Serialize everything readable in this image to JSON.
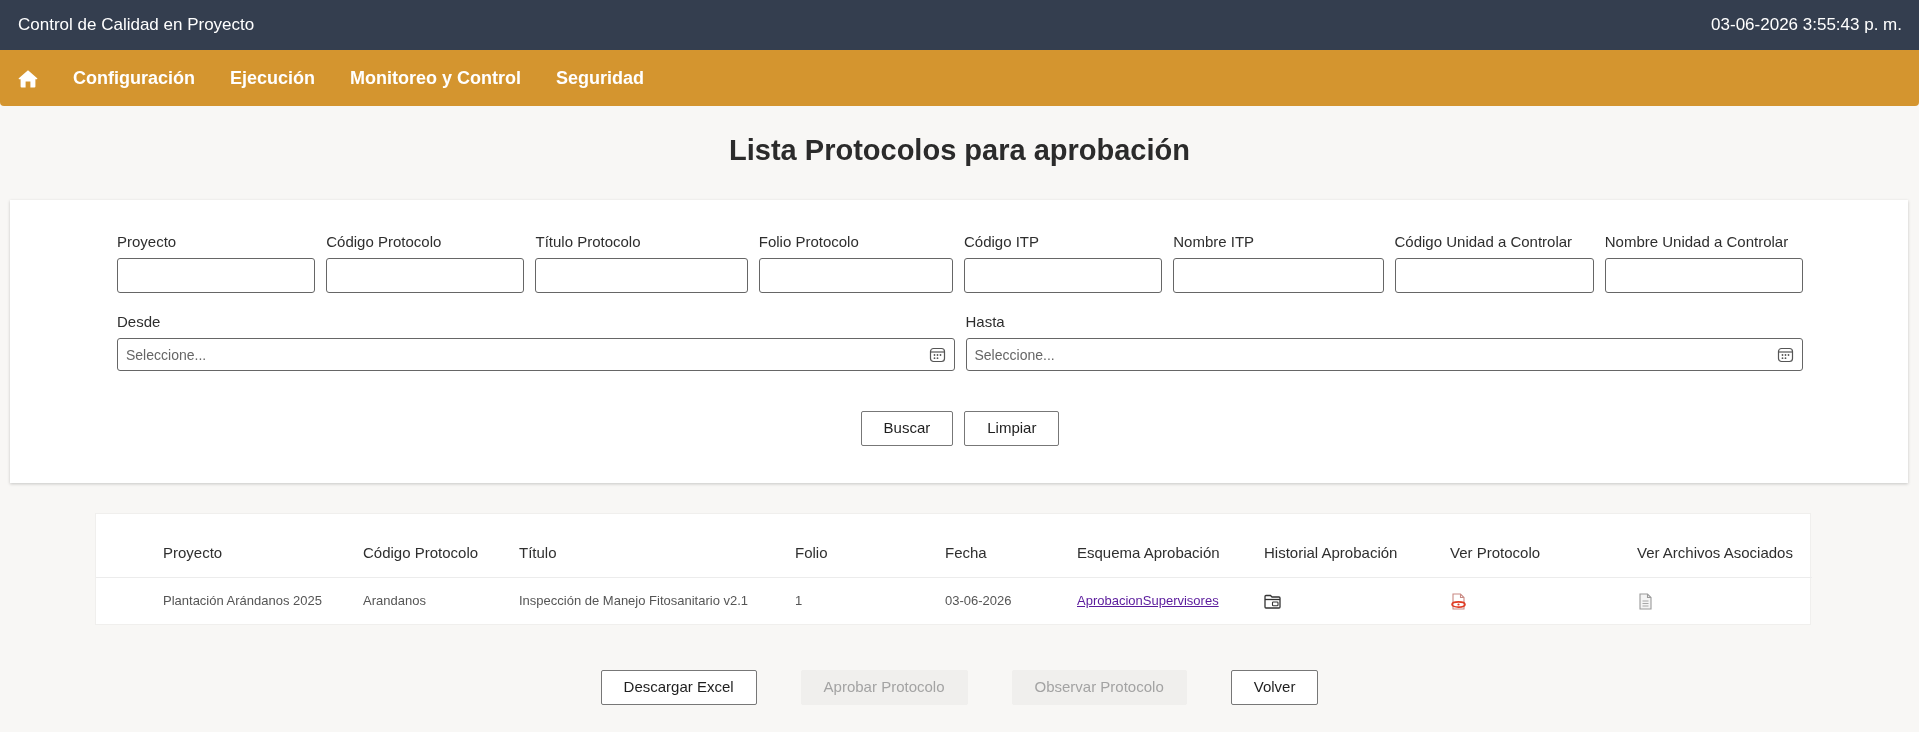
{
  "header": {
    "title": "Control de Calidad en Proyecto",
    "datetime": "03-06-2026 3:55:43 p. m."
  },
  "menu": [
    "Configuración",
    "Ejecución",
    "Monitoreo y Control",
    "Seguridad"
  ],
  "page_title": "Lista Protocolos para aprobación",
  "filters": {
    "fields": [
      {
        "label": "Proyecto"
      },
      {
        "label": "Código Protocolo"
      },
      {
        "label": "Título Protocolo"
      },
      {
        "label": "Folio Protocolo"
      },
      {
        "label": "Código ITP"
      },
      {
        "label": "Nombre ITP"
      },
      {
        "label": "Código Unidad a Controlar"
      },
      {
        "label": "Nombre Unidad a Controlar"
      }
    ],
    "date_fields": [
      {
        "label": "Desde",
        "placeholder": "Seleccione..."
      },
      {
        "label": "Hasta",
        "placeholder": "Seleccione..."
      }
    ],
    "buttons": [
      "Buscar",
      "Limpiar"
    ]
  },
  "table": {
    "columns": [
      "Proyecto",
      "Código Protocolo",
      "Título",
      "Folio",
      "Fecha",
      "Esquema Aprobación",
      "Historial Aprobación",
      "Ver Protocolo",
      "Ver Archivos Asociados"
    ],
    "rows": [
      {
        "cells": [
          {
            "kind": "text",
            "text": "Plantación Arándanos 2025"
          },
          {
            "kind": "text",
            "text": "Arandanos"
          },
          {
            "kind": "text",
            "text": "Inspección de Manejo Fitosanitario v2.1"
          },
          {
            "kind": "text",
            "text": "1"
          },
          {
            "kind": "text",
            "text": "03-06-2026"
          },
          {
            "kind": "link",
            "text": "AprobacionSupervisores"
          },
          {
            "kind": "history"
          },
          {
            "kind": "protocol"
          },
          {
            "kind": "files"
          }
        ]
      }
    ]
  },
  "actions": [
    {
      "label": "Descargar Excel",
      "disabled": false
    },
    {
      "label": "Aprobar Protocolo",
      "disabled": true
    },
    {
      "label": "Observar Protocolo",
      "disabled": true
    },
    {
      "label": "Volver",
      "disabled": false
    }
  ]
}
